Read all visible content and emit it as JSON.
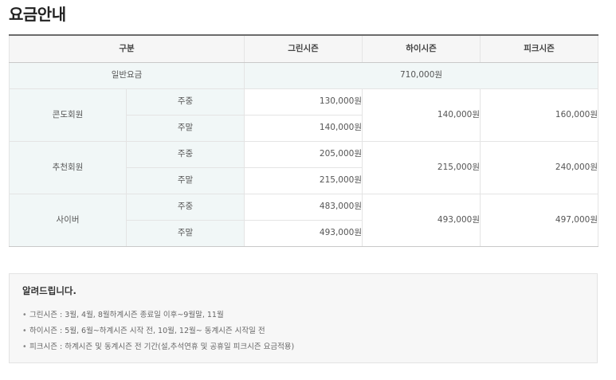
{
  "page": {
    "title": "요금안내"
  },
  "table": {
    "headers": [
      "구분",
      "그린시즌",
      "하이시즌",
      "피크시즌"
    ],
    "general": {
      "label": "일반요금",
      "price": "710,000원"
    },
    "groups": [
      {
        "name": "콘도회원",
        "weekday_label": "주중",
        "weekday_green": "130,000원",
        "weekend_label": "주말",
        "weekend_green": "140,000원",
        "high": "140,000원",
        "peak": "160,000원"
      },
      {
        "name": "추천회원",
        "weekday_label": "주중",
        "weekday_green": "205,000원",
        "weekend_label": "주말",
        "weekend_green": "215,000원",
        "high": "215,000원",
        "peak": "240,000원"
      },
      {
        "name": "사이버",
        "weekday_label": "주중",
        "weekday_green": "483,000원",
        "weekend_label": "주말",
        "weekend_green": "493,000원",
        "high": "493,000원",
        "peak": "497,000원"
      }
    ]
  },
  "notice": {
    "title": "알려드립니다.",
    "items": [
      "그린시즌 : 3월, 4월, 8월하계시즌 종료일 이후~9월말, 11월",
      "하이시즌 : 5월, 6월~하계시즌 시작 전, 10월, 12월~ 동계시즌 시작일 전",
      "피크시즌 : 하계시즌 및 동계시즌 전 기간(설,추석연휴 및 공휴일 피크시즌 요금적용)"
    ]
  }
}
